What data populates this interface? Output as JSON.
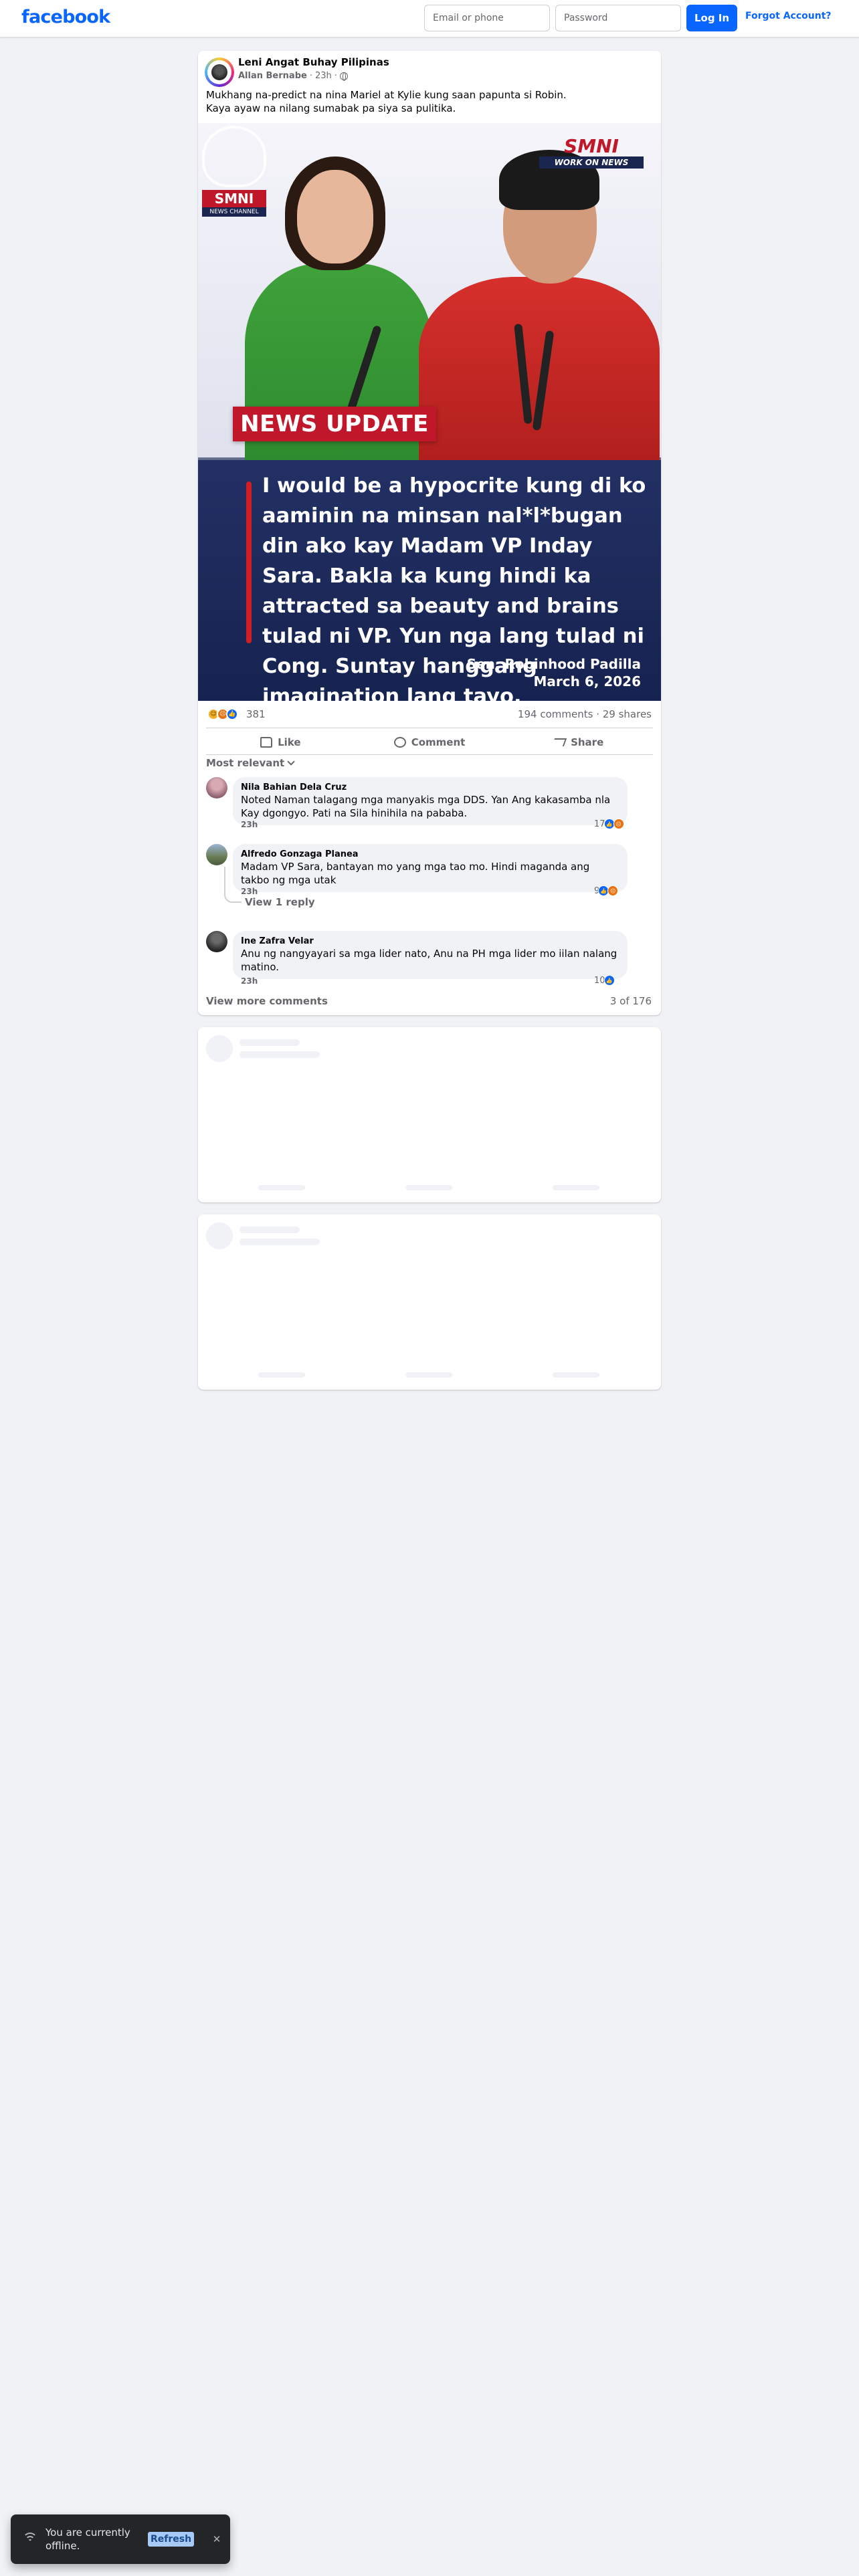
{
  "header": {
    "logo": "facebook",
    "email_placeholder": "Email or phone",
    "password_placeholder": "Password",
    "login_label": "Log In",
    "forgot_label": "Forgot Account?"
  },
  "post": {
    "page_name": "Leni Angat Buhay Pilipinas",
    "author": "Allan Bernabe",
    "time": "23h",
    "separator": "·",
    "caption_line1": "Mukhang na-predict na nina Mariel at Kylie kung saan papunta si Robin.",
    "caption_line2": "Kaya ayaw na nilang sumabak pa siya sa pulitika.",
    "image": {
      "logo_left": "SMNI",
      "logo_left_sub": "NEWS CHANNEL",
      "logo_right": "SMNI",
      "logo_right_sub": "WORK ON NEWS",
      "banner": "NEWS UPDATE",
      "quote": "I would be a hypocrite kung di ko aaminin na minsan nal*l*bugan din ako kay Madam VP Inday Sara. Bakla ka kung hindi ka attracted sa beauty and brains tulad ni VP.  Yun nga lang tulad  ni  Cong. Suntay  hanggang imagination lang tayo.",
      "byline_name": "Sen. Robinhood Padilla",
      "byline_date": "March 6, 2026"
    },
    "reaction_count": "381",
    "comments_count": "194 comments",
    "shares_count": "29 shares",
    "counts_separator": "·",
    "actions": {
      "like": "Like",
      "comment": "Comment",
      "share": "Share"
    },
    "sort_label": "Most relevant",
    "comments": [
      {
        "name": "Nila Bahian Dela Cruz",
        "text": "Noted Naman talagang mga manyakis mga DDS. Yan Ang kakasamba nla Kay dgongyo. Pati na Sila hinihila na pababa.",
        "time": "23h",
        "reacts": "17"
      },
      {
        "name": "Alfredo Gonzaga Planea",
        "text": "Madam VP Sara, bantayan mo yang mga tao mo. Hindi maganda ang takbo ng mga utak",
        "time": "23h",
        "reacts": "9",
        "view_reply": "View 1 reply"
      },
      {
        "name": "Ine Zafra Velar",
        "text": "Anu ng nangyayari sa mga lider nato, Anu na PH mga lider mo iilan nalang matino.",
        "time": "23h",
        "reacts": "10"
      }
    ],
    "view_more": "View more comments",
    "pager": "3 of 176"
  },
  "toast": {
    "message": "You are currently offline.",
    "refresh_label": "Refresh"
  },
  "colors": {
    "brand": "#0866ff",
    "page_bg": "#f0f2f5",
    "news_red": "#c0182a",
    "news_navy": "#1b2b5e"
  }
}
